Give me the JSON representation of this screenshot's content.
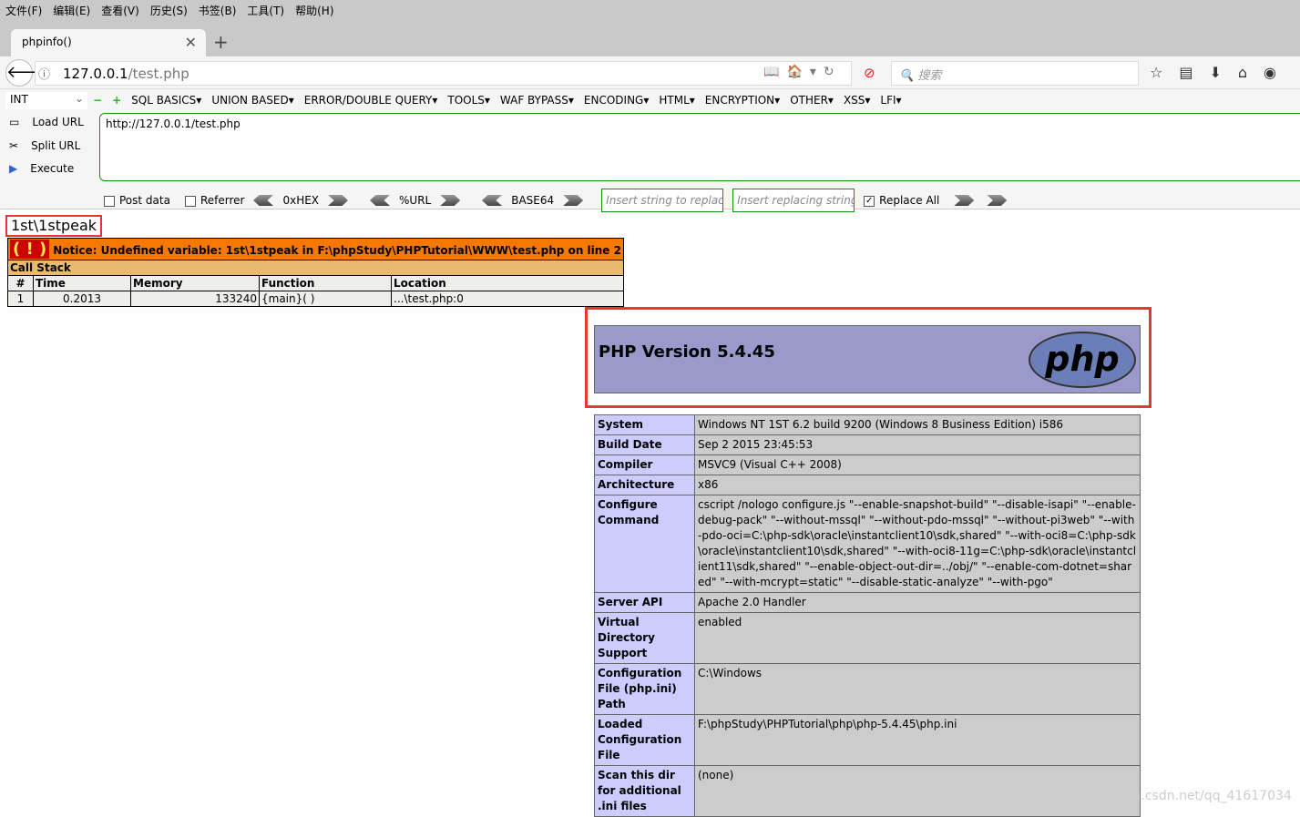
{
  "menubar": [
    "文件(F)",
    "编辑(E)",
    "查看(V)",
    "历史(S)",
    "书签(B)",
    "工具(T)",
    "帮助(H)"
  ],
  "tab": {
    "title": "phpinfo()"
  },
  "url": {
    "host": "127.0.0.1",
    "path": "/test.php"
  },
  "search": {
    "placeholder": "搜索"
  },
  "hackbar": {
    "select": "INT",
    "menus": [
      "SQL BASICS▾",
      "UNION BASED▾",
      "ERROR/DOUBLE QUERY▾",
      "TOOLS▾",
      "WAF BYPASS▾",
      "ENCODING▾",
      "HTML▾",
      "ENCRYPTION▾",
      "OTHER▾",
      "XSS▾",
      "LFI▾"
    ],
    "load": "Load URL",
    "split": "Split URL",
    "execute": "Execute",
    "textarea": "http://127.0.0.1/test.php",
    "post": "Post data",
    "referrer": "Referrer",
    "hex": "0xHEX",
    "url": "%URL",
    "b64": "BASE64",
    "replace_ph": "Insert string to replace",
    "replacing_ph": "Insert replacing string",
    "replace_all": "Replace All"
  },
  "page": {
    "echo": "1st\\1stpeak",
    "notice": "Notice: Undefined variable: 1st\\1stpeak in F:\\phpStudy\\PHPTutorial\\WWW\\test.php on line 2",
    "callstack": "Call Stack",
    "headers": [
      "#",
      "Time",
      "Memory",
      "Function",
      "Location"
    ],
    "row": [
      "1",
      "0.2013",
      "133240",
      "{main}( )",
      "...\\test.php:0"
    ],
    "php_version": "PHP Version 5.4.45",
    "logo": "php",
    "info": [
      [
        "System",
        "Windows NT 1ST 6.2 build 9200 (Windows 8 Business Edition) i586"
      ],
      [
        "Build Date",
        "Sep 2 2015 23:45:53"
      ],
      [
        "Compiler",
        "MSVC9 (Visual C++ 2008)"
      ],
      [
        "Architecture",
        "x86"
      ],
      [
        "Configure Command",
        "cscript /nologo configure.js \"--enable-snapshot-build\" \"--disable-isapi\" \"--enable-debug-pack\" \"--without-mssql\" \"--without-pdo-mssql\" \"--without-pi3web\" \"--with-pdo-oci=C:\\php-sdk\\oracle\\instantclient10\\sdk,shared\" \"--with-oci8=C:\\php-sdk\\oracle\\instantclient10\\sdk,shared\" \"--with-oci8-11g=C:\\php-sdk\\oracle\\instantclient11\\sdk,shared\" \"--enable-object-out-dir=../obj/\" \"--enable-com-dotnet=shared\" \"--with-mcrypt=static\" \"--disable-static-analyze\" \"--with-pgo\""
      ],
      [
        "Server API",
        "Apache 2.0 Handler"
      ],
      [
        "Virtual Directory Support",
        "enabled"
      ],
      [
        "Configuration File (php.ini) Path",
        "C:\\Windows"
      ],
      [
        "Loaded Configuration File",
        "F:\\phpStudy\\PHPTutorial\\php\\php-5.4.45\\php.ini"
      ],
      [
        "Scan this dir for additional .ini files",
        "(none)"
      ]
    ]
  },
  "watermark": "https://blog.csdn.net/qq_41617034"
}
